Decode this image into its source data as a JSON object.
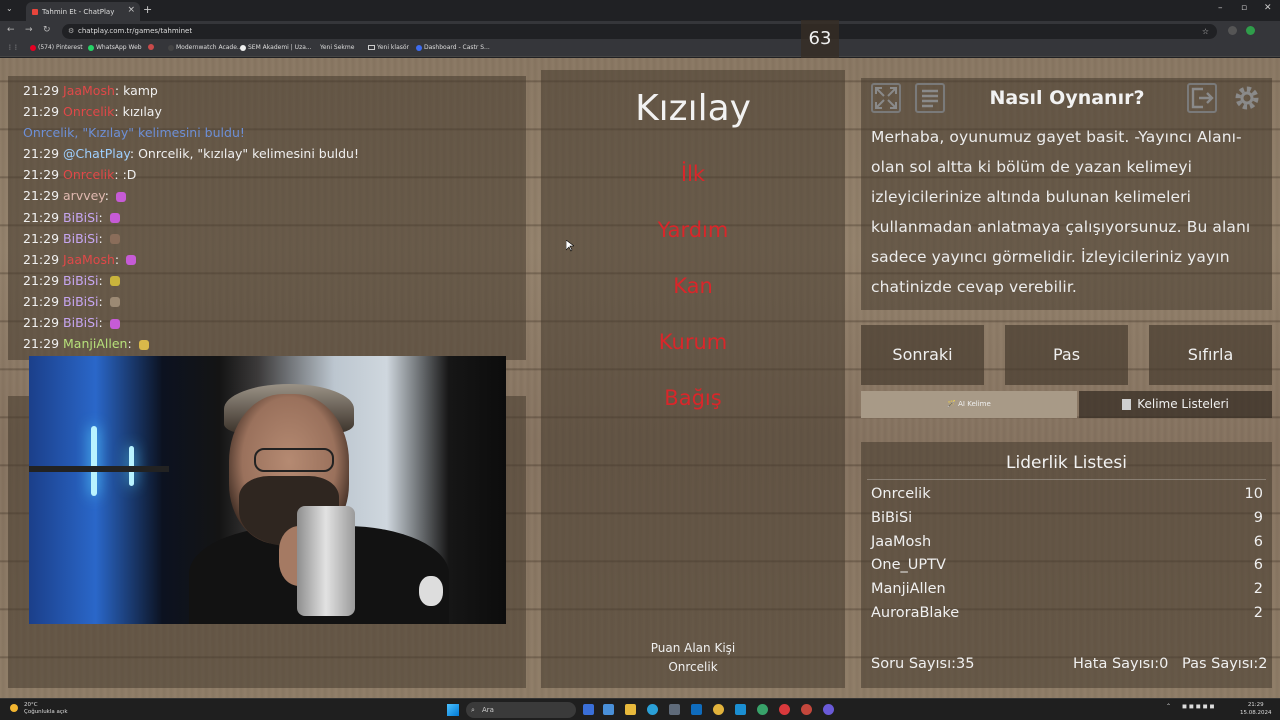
{
  "browser": {
    "tab_title": "Tahmin Et - ChatPlay",
    "tab_close": "×",
    "new_tab": "+",
    "url": "chatplay.com.tr/games/tahminet",
    "back": "←",
    "forward": "→",
    "reload": "↻",
    "tab_menu": "⌄",
    "minimize": "–",
    "maximize": "▫",
    "close": "✕",
    "bookmarks": [
      {
        "label": "(574) Pinterest",
        "color": "#e60023"
      },
      {
        "label": "WhatsApp Web",
        "color": "#25d366"
      },
      {
        "label": "",
        "color": "#c94a4a"
      },
      {
        "label": "Modernwatch Acade...",
        "color": "#444444"
      },
      {
        "label": "SEM Akademi | Uza...",
        "color": "#eeeeee"
      },
      {
        "label": "Yeni Sekme",
        "color": ""
      },
      {
        "label": "Yeni klasör",
        "color": ""
      },
      {
        "label": "Dashboard - Castr S...",
        "color": "#3d6cf0"
      }
    ]
  },
  "chat": {
    "lines": [
      {
        "time": "21:29",
        "user": "JaaMosh",
        "user_color": "#e04848",
        "sep": ": ",
        "text": "kamp",
        "emote": ""
      },
      {
        "time": "21:29",
        "user": "Onrcelik",
        "user_color": "#e04848",
        "sep": ": ",
        "text": "kızılay",
        "emote": ""
      },
      {
        "time": "",
        "user": "",
        "user_color": "",
        "sep": "",
        "text": "Onrcelik, \"Kızılay\" kelimesini buldu!",
        "emote": "",
        "system": true
      },
      {
        "time": "21:29",
        "user": "@ChatPlay",
        "user_color": "#9fd0ff",
        "sep": ": ",
        "text": "Onrcelik, \"kızılay\" kelimesini buldu!",
        "emote": ""
      },
      {
        "time": "21:29",
        "user": "Onrcelik",
        "user_color": "#e04848",
        "sep": ": ",
        "text": ":D",
        "emote": ""
      },
      {
        "time": "21:29",
        "user": "arvvey",
        "user_color": "#e0b9b0",
        "sep": ": ",
        "text": "",
        "emote": "#c65bd6"
      },
      {
        "time": "21:29",
        "user": "BiBiSi",
        "user_color": "#c6a6f0",
        "sep": ": ",
        "text": "",
        "emote": "#c65bd6"
      },
      {
        "time": "21:29",
        "user": "BiBiSi",
        "user_color": "#c6a6f0",
        "sep": ": ",
        "text": "",
        "emote": "#8a6d5a"
      },
      {
        "time": "21:29",
        "user": "JaaMosh",
        "user_color": "#e04848",
        "sep": ": ",
        "text": "",
        "emote": "#c65bd6"
      },
      {
        "time": "21:29",
        "user": "BiBiSi",
        "user_color": "#c6a6f0",
        "sep": ": ",
        "text": "",
        "emote": "#c9b43c"
      },
      {
        "time": "21:29",
        "user": "BiBiSi",
        "user_color": "#c6a6f0",
        "sep": ": ",
        "text": "",
        "emote": "#9c8a74"
      },
      {
        "time": "21:29",
        "user": "BiBiSi",
        "user_color": "#c6a6f0",
        "sep": ": ",
        "text": "",
        "emote": "#c65bd6"
      },
      {
        "time": "21:29",
        "user": "ManjiAllen",
        "user_color": "#b6e07a",
        "sep": ": ",
        "text": "",
        "emote": "#d9b84a"
      }
    ]
  },
  "game": {
    "timer": "63",
    "word": "Kızılay",
    "taboo_words": [
      "İlk",
      "Yardım",
      "Kan",
      "Kurum",
      "Bağış"
    ],
    "scorer_label": "Puan Alan Kişi",
    "scorer_name": "Onrcelik"
  },
  "help": {
    "title": "Nasıl Oynanır?",
    "text": "Merhaba, oyunumuz gayet basit. -Yayıncı Alanı- olan sol altta ki bölüm de yazan kelimeyi izleyicilerinize altında bulunan kelimeleri kullanmadan anlatmaya çalışıyorsunuz. Bu alanı sadece yayıncı görmelidir. İzleyicileriniz yayın chatinizde cevap verebilir."
  },
  "actions": {
    "next": "Sonraki",
    "pass": "Pas",
    "reset": "Sıfırla",
    "ai_tab": "🪄 AI Kelime",
    "list_tab": "Kelime Listeleri"
  },
  "leaderboard": {
    "title": "Liderlik Listesi",
    "rows": [
      {
        "name": "Onrcelik",
        "score": "10"
      },
      {
        "name": "BiBiSi",
        "score": "9"
      },
      {
        "name": "JaaMosh",
        "score": "6"
      },
      {
        "name": "One_UPTV",
        "score": "6"
      },
      {
        "name": "ManjiAllen",
        "score": "2"
      },
      {
        "name": "AuroraBlake",
        "score": "2"
      }
    ]
  },
  "stats": {
    "questions": "Soru Sayısı:35",
    "errors": "Hata Sayısı:0",
    "passes": "Pas Sayısı:2"
  },
  "taskbar": {
    "weather_temp": "20°C",
    "weather_desc": "Çoğunlukla açık",
    "search": "Ara",
    "time": "21:29",
    "date": "15.08.2024"
  },
  "colors": {
    "taboo": "#d9262a",
    "wood": "#8f7d67"
  }
}
